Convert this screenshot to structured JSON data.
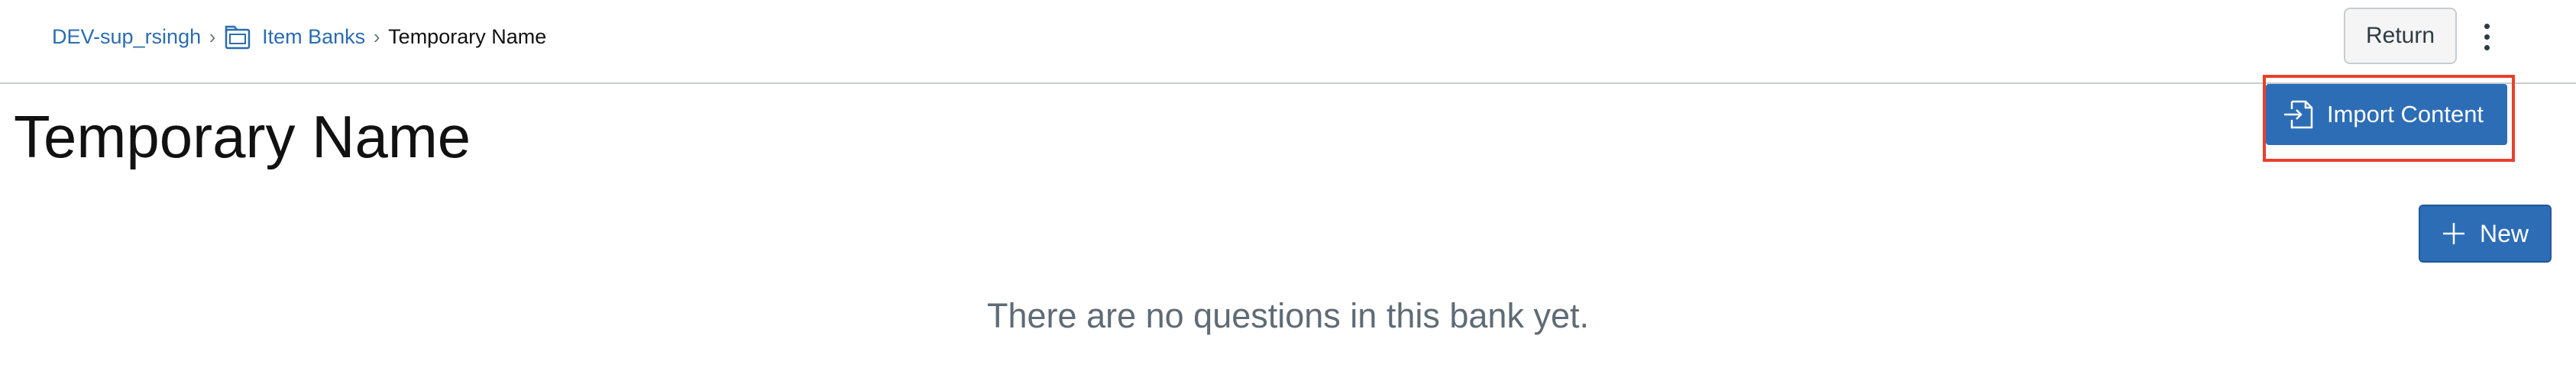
{
  "breadcrumb": {
    "course": "DEV-sup_rsingh",
    "item_banks": "Item Banks",
    "current": "Temporary Name",
    "separator": "›"
  },
  "header": {
    "return_label": "Return"
  },
  "menu": {
    "import_content_label": "Import Content"
  },
  "main": {
    "title": "Temporary Name",
    "new_label": "New",
    "empty_message": "There are no questions in this bank yet."
  },
  "colors": {
    "primary": "#2c6db6",
    "link": "#2b6cb0",
    "highlight": "#e8402c"
  },
  "icons": {
    "folder": "folder-icon",
    "import": "import-icon",
    "plus": "plus-icon",
    "kebab": "kebab-menu-icon"
  }
}
